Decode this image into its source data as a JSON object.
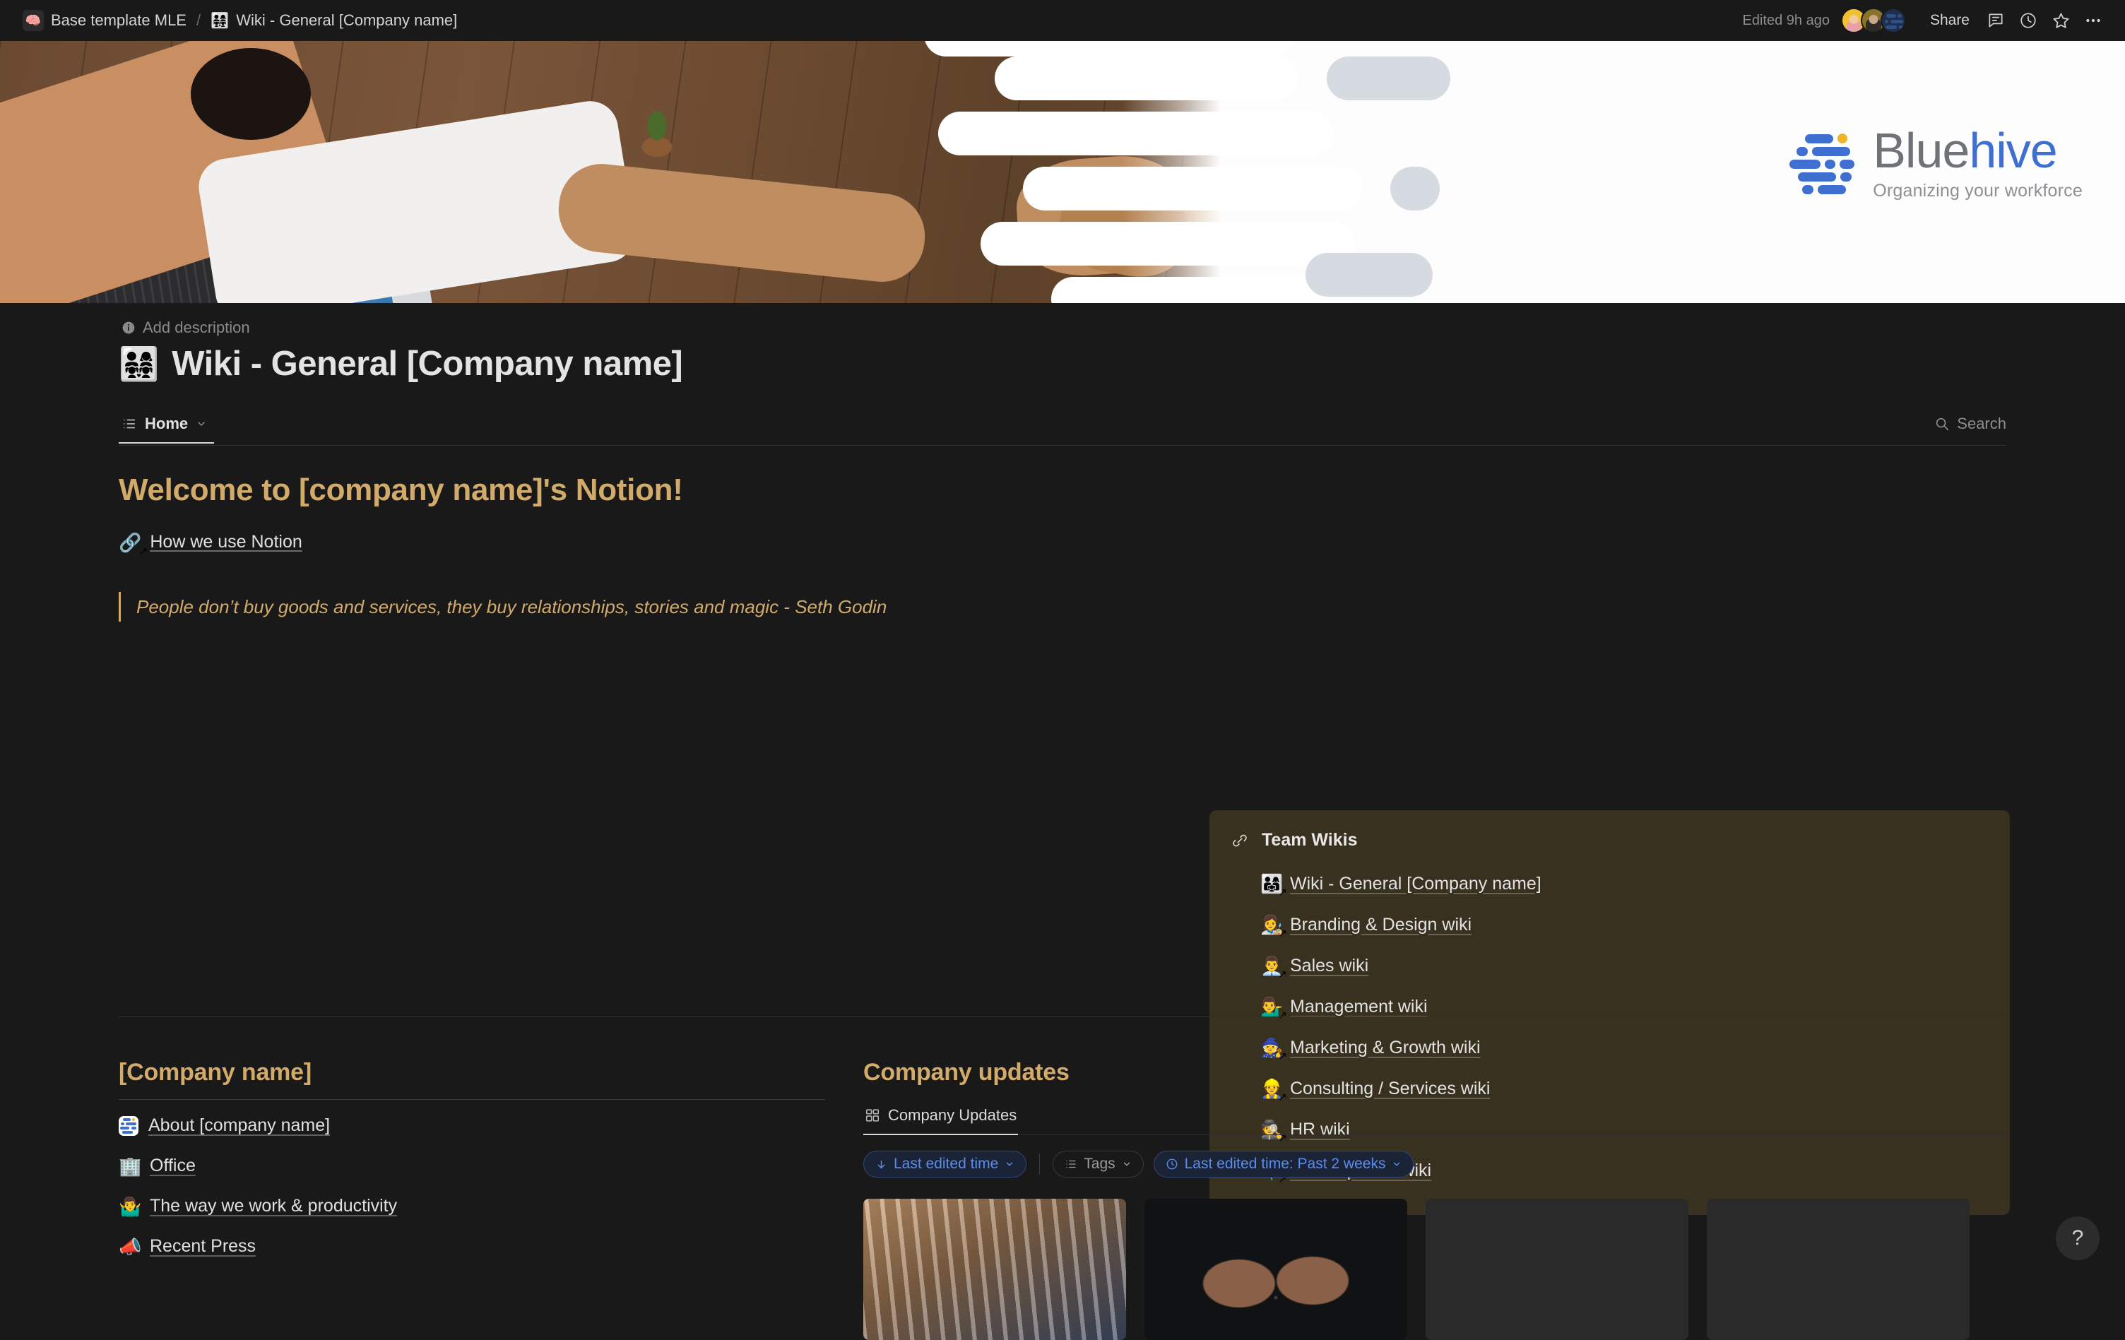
{
  "topbar": {
    "breadcrumb": {
      "workspace_icon": "🧠",
      "workspace": "Base template MLE",
      "separator": "/",
      "page_emoji": "👨‍👩‍👧‍👧",
      "page": "Wiki - General [Company name]"
    },
    "edited": "Edited 9h ago",
    "share_label": "Share",
    "icons": [
      "comment-icon",
      "history-icon",
      "star-icon",
      "more-icon"
    ]
  },
  "cover": {
    "logo": {
      "word_a": "Blue",
      "word_b": "hive",
      "tagline": "Organizing your workforce"
    }
  },
  "page": {
    "description_placeholder": "Add description",
    "title_emoji": "👨‍👩‍👧‍👧",
    "title": "Wiki - General [Company name]"
  },
  "tabs": {
    "items": [
      {
        "label": "Home",
        "icon": "list-icon",
        "active": true
      }
    ],
    "search_label": "Search"
  },
  "hero": {
    "heading": "Welcome to [company name]'s Notion!",
    "page_link": {
      "emoji": "🔗",
      "label": "How we use Notion"
    },
    "quote": "People don’t buy goods and services, they buy relationships, stories and magic - Seth Godin"
  },
  "callout": {
    "icon": "link-icon",
    "title": "Team Wikis",
    "items": [
      {
        "emoji": "👨‍👩‍👧",
        "label": "Wiki - General [Company name]"
      },
      {
        "emoji": "👩‍🎨",
        "label": "Branding & Design wiki"
      },
      {
        "emoji": "👨‍💼",
        "label": "Sales wiki"
      },
      {
        "emoji": "💁‍♂️",
        "label": "Management wiki"
      },
      {
        "emoji": "🧙",
        "label": "Marketing & Growth wiki"
      },
      {
        "emoji": "👷",
        "label": "Consulting / Services wiki"
      },
      {
        "emoji": "🕵️",
        "label": "HR wiki"
      },
      {
        "emoji": "📍",
        "label": "Team specific wiki"
      }
    ]
  },
  "company_section": {
    "heading": "[Company name]",
    "links": [
      {
        "emoji": "logo",
        "label": "About [company name]"
      },
      {
        "emoji": "🏢",
        "label": "Office"
      },
      {
        "emoji": "🤷‍♂️",
        "label": "The way we work & productivity"
      },
      {
        "emoji": "📣",
        "label": "Recent Press"
      }
    ]
  },
  "updates_section": {
    "heading": "Company updates",
    "view_tab": {
      "label": "Company Updates",
      "icon": "gallery-icon",
      "active": true
    },
    "chips": [
      {
        "label": "Last edited time",
        "icon": "arrow-down-icon",
        "style": "blue",
        "chevron": true
      },
      {
        "label": "Tags",
        "icon": "list-icon",
        "style": "gray",
        "chevron": true
      },
      {
        "label": "Last edited time: Past 2 weeks",
        "icon": "clock-icon",
        "style": "blue",
        "chevron": true
      }
    ],
    "cards": [
      "photo-bookshelf",
      "photo-hands-water",
      "blank",
      "blank"
    ]
  },
  "help": {
    "label": "?"
  },
  "colors": {
    "page_bg": "#191919",
    "accent_gold": "#d2ab6a",
    "callout_bg": "#39311f",
    "chip_blue": "#5a8cf0",
    "brand_blue": "#3f6fd0",
    "brand_yellow": "#f0b429"
  }
}
